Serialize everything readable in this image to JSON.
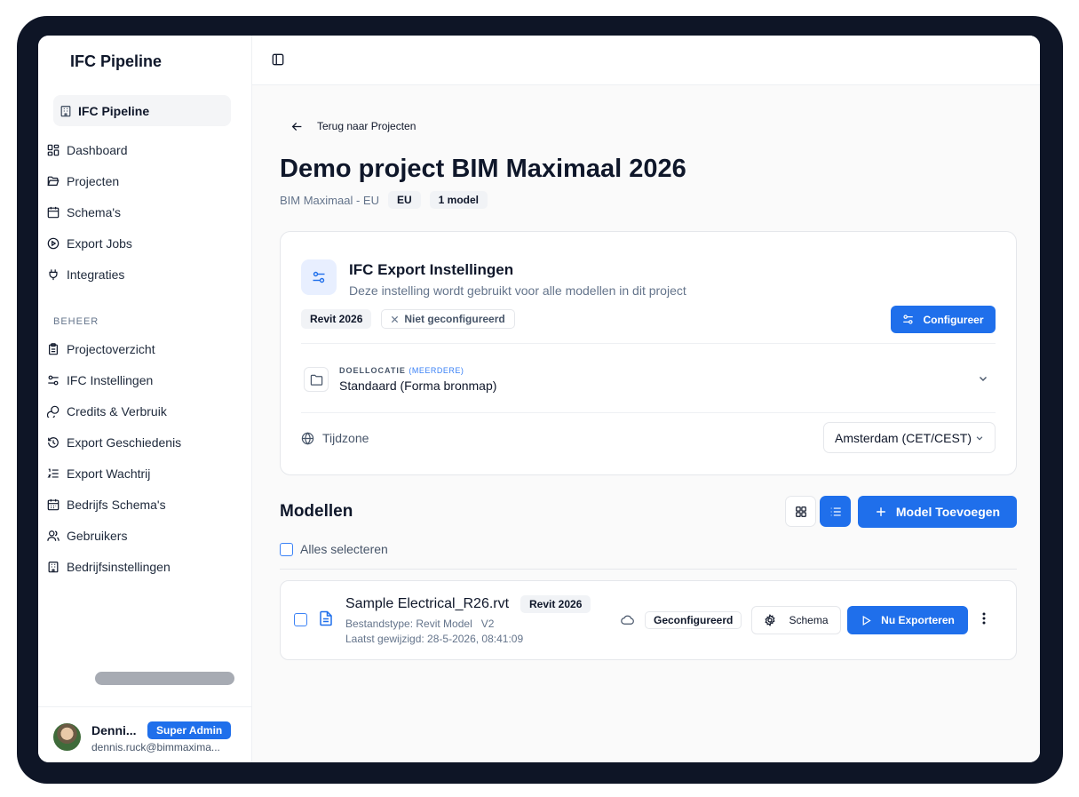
{
  "sidebar": {
    "brand": "IFC Pipeline",
    "workspace": "IFC Pipeline",
    "nav": [
      {
        "label": "Dashboard",
        "icon": "dashboard-icon"
      },
      {
        "label": "Projecten",
        "icon": "folder-open-icon"
      },
      {
        "label": "Schema's",
        "icon": "calendar-icon"
      },
      {
        "label": "Export Jobs",
        "icon": "play-circle-icon"
      },
      {
        "label": "Integraties",
        "icon": "plug-icon"
      }
    ],
    "section_label": "BEHEER",
    "admin_nav": [
      {
        "label": "Projectoverzicht",
        "icon": "clipboard-icon"
      },
      {
        "label": "IFC Instellingen",
        "icon": "sliders-icon"
      },
      {
        "label": "Credits & Verbruik",
        "icon": "coins-icon"
      },
      {
        "label": "Export Geschiedenis",
        "icon": "history-icon"
      },
      {
        "label": "Export Wachtrij",
        "icon": "list-ordered-icon"
      },
      {
        "label": "Bedrijfs Schema's",
        "icon": "calendar-grid-icon"
      },
      {
        "label": "Gebruikers",
        "icon": "users-icon"
      },
      {
        "label": "Bedrijfsinstellingen",
        "icon": "building-icon"
      }
    ],
    "user": {
      "name": "Denni...",
      "role": "Super Admin",
      "email": "dennis.ruck@bimmaxima..."
    }
  },
  "main": {
    "back_link": "Terug naar Projecten",
    "title": "Demo project BIM Maximaal 2026",
    "company": "BIM Maximaal - EU",
    "region_tag": "EU",
    "model_count_tag": "1 model",
    "settings_card": {
      "title": "IFC Export Instellingen",
      "subtitle": "Deze instelling wordt gebruikt voor alle modellen in dit project",
      "version_tag": "Revit 2026",
      "status_tag": "Niet geconfigureerd",
      "configure_label": "Configureer",
      "destination_label": "DOELLOCATIE",
      "destination_hint": "(MEERDERE)",
      "destination_value": "Standaard (Forma bronmap)",
      "timezone_label": "Tijdzone",
      "timezone_value": "Amsterdam (CET/CEST)"
    },
    "models_section": {
      "title": "Modellen",
      "add_label": "Model Toevoegen",
      "select_all_label": "Alles selecteren",
      "models": [
        {
          "name": "Sample Electrical_R26.rvt",
          "version_tag": "Revit 2026",
          "file_type": "Bestandstype: Revit Model",
          "revision": "V2",
          "modified": "Laatst gewijzigd: 28-5-2026, 08:41:09",
          "status": "Geconfigureerd",
          "schema_label": "Schema",
          "export_label": "Nu Exporteren"
        }
      ]
    }
  },
  "colors": {
    "accent": "#1f6feb",
    "frame": "#0e1526"
  }
}
